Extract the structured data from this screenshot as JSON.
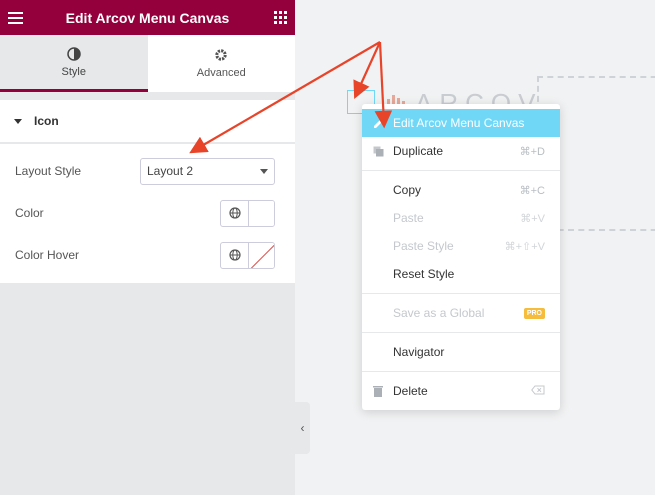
{
  "panel": {
    "title": "Edit Arcov Menu Canvas",
    "tabs": [
      {
        "label": "Style",
        "icon": "contrast-icon"
      },
      {
        "label": "Advanced",
        "icon": "gear-icon"
      }
    ],
    "section_title": "Icon",
    "controls": {
      "layout_style_label": "Layout Style",
      "layout_style_value": "Layout 2",
      "color_label": "Color",
      "color_hover_label": "Color Hover"
    }
  },
  "canvas": {
    "logo_text": "ARCOV"
  },
  "context_menu": {
    "items": [
      {
        "label": "Edit Arcov Menu Canvas",
        "shortcut": "",
        "highlighted": true
      },
      {
        "label": "Duplicate",
        "shortcut": "⌘+D"
      },
      {
        "label": "Copy",
        "shortcut": "⌘+C"
      },
      {
        "label": "Paste",
        "shortcut": "⌘+V",
        "disabled": true
      },
      {
        "label": "Paste Style",
        "shortcut": "⌘+⇧+V",
        "disabled": true
      },
      {
        "label": "Reset Style",
        "shortcut": ""
      },
      {
        "label": "Save as a Global",
        "badge": "PRO",
        "disabled": true
      },
      {
        "label": "Navigator",
        "shortcut": ""
      },
      {
        "label": "Delete",
        "shortcut": ""
      }
    ]
  },
  "colors": {
    "brand": "#93003c",
    "highlight": "#71d7f7",
    "arrow": "#e8442a",
    "pro_badge": "#f6bc3b"
  }
}
